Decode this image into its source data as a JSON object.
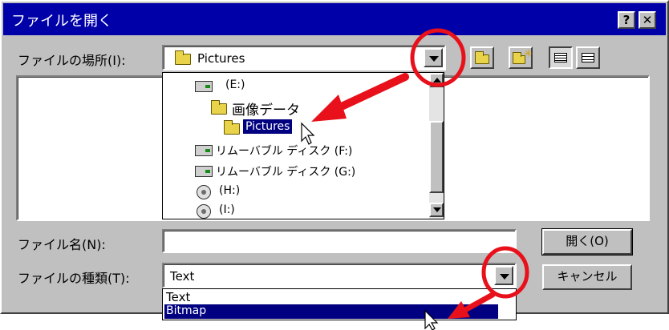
{
  "window": {
    "title": "ファイルを開く",
    "help_button": "?",
    "close_button": "✕"
  },
  "location": {
    "label": "ファイルの場所(I):",
    "value": "Pictures"
  },
  "folder_tree": [
    {
      "label": "(E:)",
      "icon": "drive-icon",
      "selected": false
    },
    {
      "label": "画像データ",
      "icon": "folder-icon",
      "selected": false
    },
    {
      "label": "Pictures",
      "icon": "folder-open-icon",
      "selected": true
    },
    {
      "label": "リムーバブル ディスク (F:)",
      "icon": "removable-drive-icon",
      "selected": false
    },
    {
      "label": "リムーバブル ディスク (G:)",
      "icon": "removable-drive-icon",
      "selected": false
    },
    {
      "label": "(H:)",
      "icon": "cd-drive-icon",
      "selected": false
    },
    {
      "label": "(I:)",
      "icon": "cd-drive-icon",
      "selected": false
    }
  ],
  "filename": {
    "label": "ファイル名(N):",
    "value": ""
  },
  "filetype": {
    "label": "ファイルの種類(T):",
    "value": "Text",
    "options": [
      "Text",
      "Bitmap"
    ],
    "highlighted": "Bitmap"
  },
  "buttons": {
    "open": "開く(O)",
    "cancel": "キャンセル"
  },
  "colors": {
    "titlebar": "#0000a8",
    "face": "#c0c0c0",
    "selection": "#000080",
    "annotation": "#e8101a"
  }
}
